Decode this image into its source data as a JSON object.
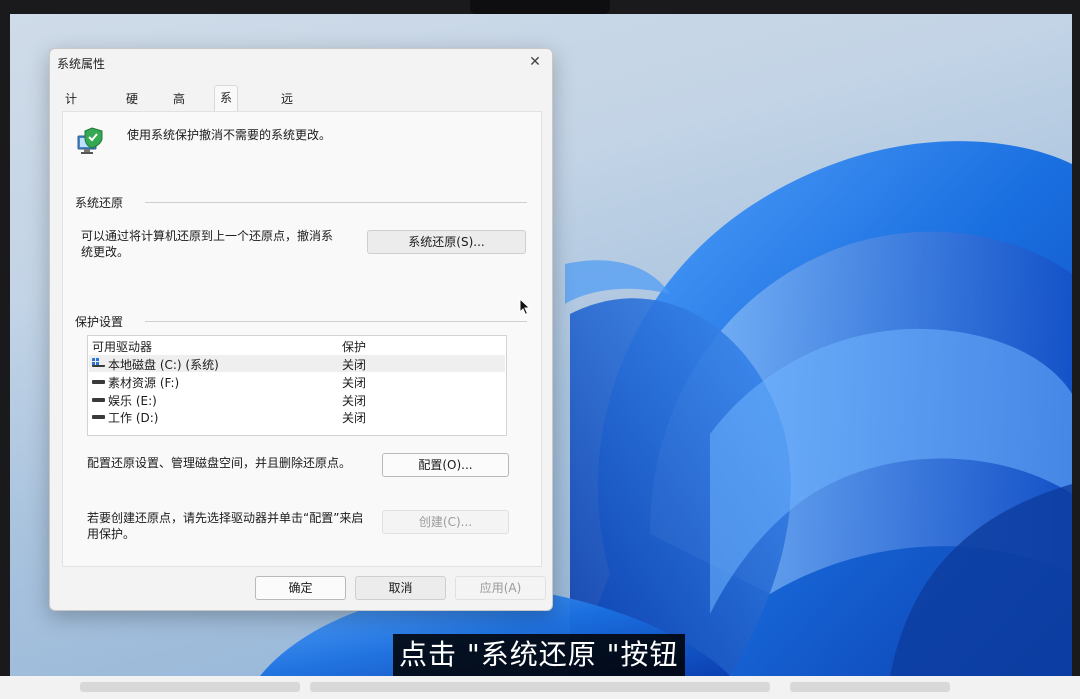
{
  "dialog": {
    "title": "系统属性",
    "close_glyph": "✕",
    "tabs": [
      "计算机名",
      "硬件",
      "高级",
      "系统保护",
      "远程"
    ],
    "intro": "使用系统保护撤消不需要的系统更改。",
    "restore": {
      "group_label": "系统还原",
      "description_line1": "可以通过将计算机还原到上一个还原点，撤消系",
      "description_line2": "统更改。",
      "button": "系统还原(S)..."
    },
    "protection": {
      "group_label": "保护设置",
      "col_drive": "可用驱动器",
      "col_protection": "保护",
      "drives": [
        {
          "name": "本地磁盘 (C:) (系统)",
          "protection": "关闭",
          "system": true
        },
        {
          "name": "素材资源 (F:)",
          "protection": "关闭",
          "system": false
        },
        {
          "name": "娱乐 (E:)",
          "protection": "关闭",
          "system": false
        },
        {
          "name": "工作 (D:)",
          "protection": "关闭",
          "system": false
        }
      ],
      "configure_text": "配置还原设置、管理磁盘空间，并且删除还原点。",
      "configure_button": "配置(O)...",
      "create_text_line1": "若要创建还原点，请先选择驱动器并单击“配置”来启",
      "create_text_line2": "用保护。",
      "create_button": "创建(C)..."
    },
    "footer": {
      "ok": "确定",
      "cancel": "取消",
      "apply": "应用(A)"
    }
  },
  "caption": "点击 \"系统还原 \"按钮",
  "colors": {
    "wallpaper_accent": "#1a6fe0",
    "wallpaper_dark": "#0b3fb0"
  }
}
